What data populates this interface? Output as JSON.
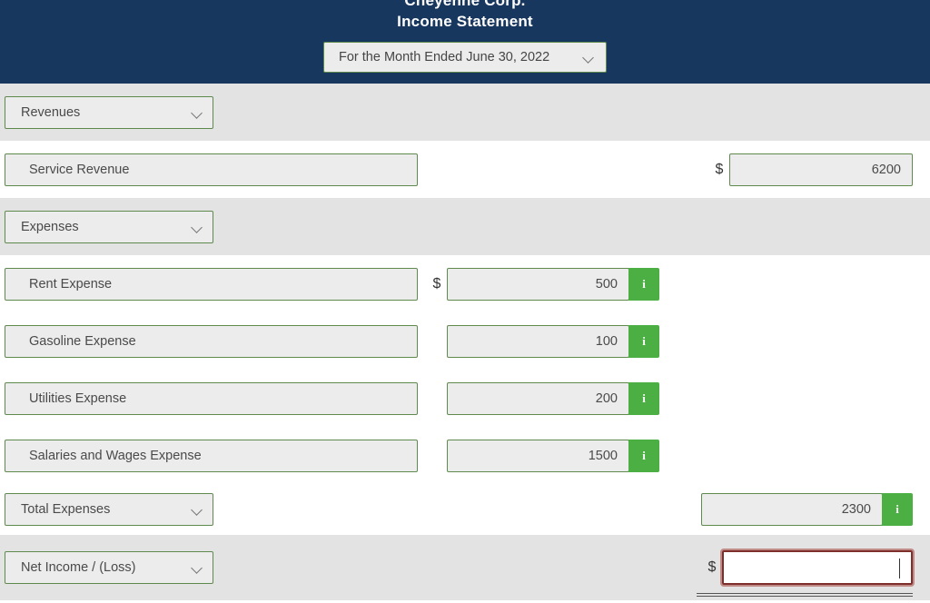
{
  "header": {
    "company": "Cheyenne Corp.",
    "title": "Income Statement",
    "period": "For the Month Ended June 30, 2022",
    "period_caret_icon": "chevron-down-icon",
    "background_color": "#17375e"
  },
  "theme": {
    "field_border": "#5f8a4e",
    "field_background": "#ececec",
    "info_button_color": "#4caf43",
    "focus_border": "#7e2f2c",
    "shaded_row": "#e3e3e3"
  },
  "currency_symbol": "$",
  "info_glyph": "i",
  "sections": {
    "revenues": {
      "header_label": "Revenues",
      "items": [
        {
          "label": "Service Revenue",
          "amount": "6200",
          "currency": "$"
        }
      ]
    },
    "expenses": {
      "header_label": "Expenses",
      "items": [
        {
          "label": "Rent Expense",
          "amount": "500",
          "currency": "$"
        },
        {
          "label": "Gasoline Expense",
          "amount": "100",
          "currency": ""
        },
        {
          "label": "Utilities Expense",
          "amount": "200",
          "currency": ""
        },
        {
          "label": "Salaries and Wages Expense",
          "amount": "1500",
          "currency": ""
        }
      ],
      "total_label": "Total Expenses",
      "total_amount": "2300"
    },
    "net_income": {
      "label": "Net Income / (Loss)",
      "currency": "$",
      "value": "",
      "placeholder": ""
    }
  }
}
